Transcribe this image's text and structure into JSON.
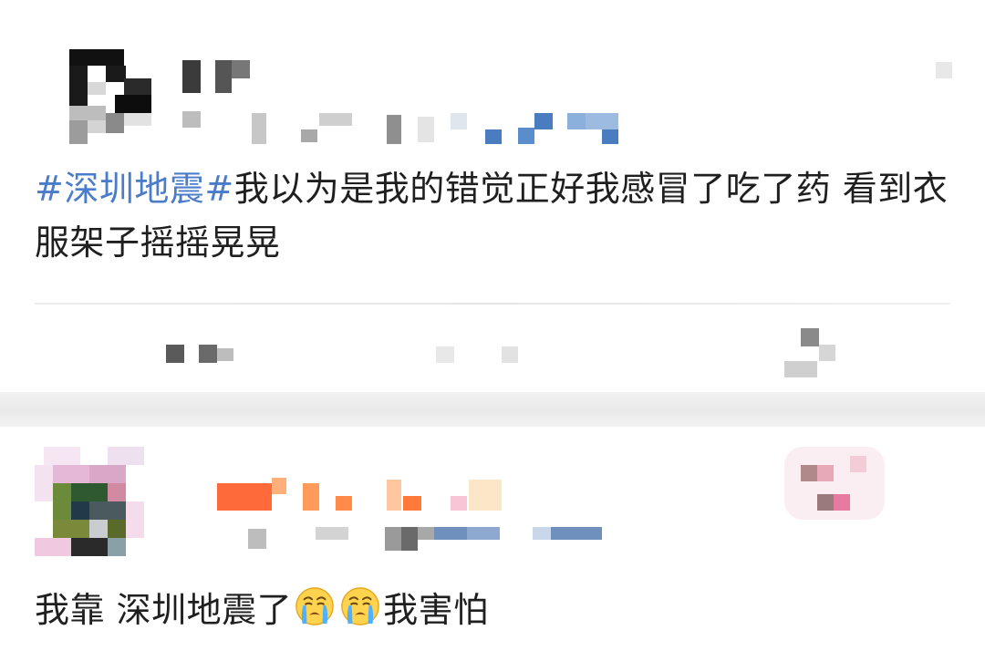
{
  "posts": [
    {
      "topic": "#深圳地震#",
      "body": "我以为是我的错觉正好我感冒了吃了药 看到衣服架子摇摇晃晃"
    },
    {
      "body_before": "我靠 深圳地震了",
      "emoji_name": "loudly-crying-face",
      "body_after": "我害怕"
    }
  ],
  "colors": {
    "topic": "#4a7cc9",
    "text": "#1f1f1f",
    "separator_band": "#eeeeee"
  },
  "icons": [
    "avatar-icon",
    "more-icon",
    "emoji-crying-icon"
  ]
}
